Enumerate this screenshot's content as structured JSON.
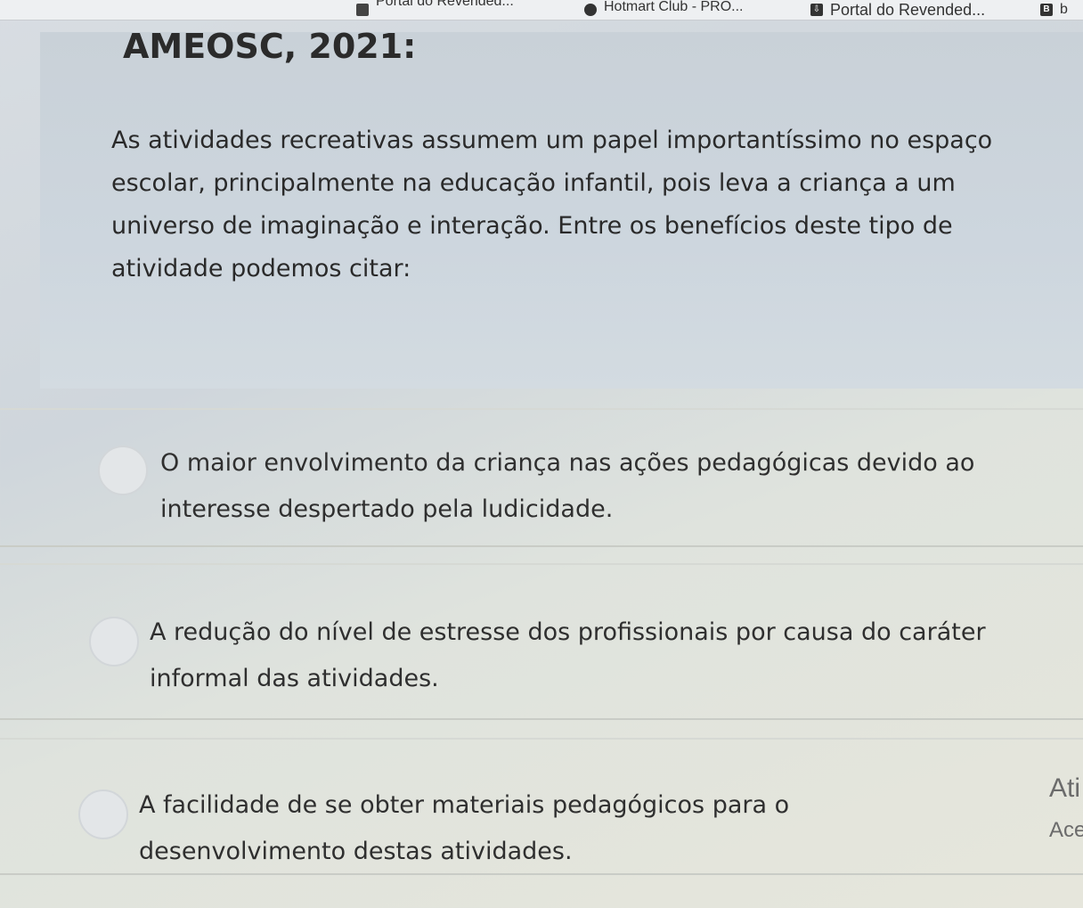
{
  "bookmarks": [
    {
      "label": "Portal do Revended...",
      "icon": "bookmark-icon"
    },
    {
      "label": "Hotmart Club - PRO...",
      "icon": "hotmart-icon"
    },
    {
      "label": "Portal do Revended...",
      "icon": "download-icon"
    },
    {
      "label": "b",
      "icon": "b-icon"
    }
  ],
  "question": {
    "title": "AMEOSC, 2021:",
    "text": "As atividades recreativas assumem um papel importantíssimo no espaço escolar, principalmente na educação infantil, pois leva a criança a um universo de imaginação e interação. Entre os benefícios deste tipo de atividade podemos citar:"
  },
  "options": [
    {
      "text": "O maior envolvimento da criança nas ações pedagógicas devido ao interesse despertado pela ludicidade."
    },
    {
      "text": "A redução do nível de estresse dos profissionais por causa do caráter informal das atividades."
    },
    {
      "text": "A facilidade de se obter materiais pedagógicos para o desenvolvimento destas atividades."
    }
  ],
  "side_panel": {
    "line1": "Ati",
    "line2": "Ace"
  }
}
